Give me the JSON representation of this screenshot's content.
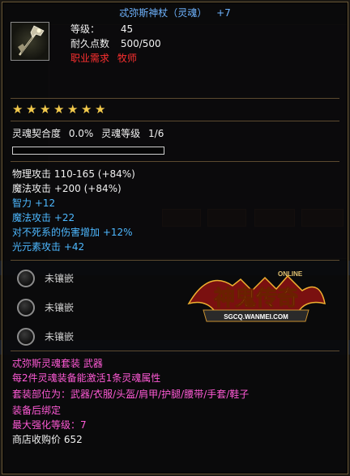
{
  "item": {
    "name": "忒弥斯神杖（灵魂）",
    "enhance": "+7",
    "level_label": "等级：",
    "level_value": "45",
    "durability_label": "耐久点数",
    "durability_value": "500/500",
    "class_req_label": "职业需求",
    "class_req_value": "牧师",
    "stars": 7,
    "soul": {
      "fit_label": "灵魂契合度",
      "fit_value": "0.0%",
      "level_label": "灵魂等级",
      "level_value": "1/6",
      "progress": 0
    },
    "stats": [
      {
        "text": "物理攻击 110-165 (+84%)",
        "color": "white"
      },
      {
        "text": "魔法攻击 +200 (+84%)",
        "color": "white"
      },
      {
        "text": "智力 +12",
        "color": "blue"
      },
      {
        "text": "魔法攻击 +22",
        "color": "blue"
      },
      {
        "text": "对不死系的伤害增加 +12%",
        "color": "blue"
      },
      {
        "text": "光元素攻击 +42",
        "color": "blue"
      }
    ],
    "sockets": [
      "未镶嵌",
      "未镶嵌",
      "未镶嵌"
    ],
    "set_name": "忒弥斯灵魂套装 武器",
    "set_desc": "每2件灵魂装备能激活1条灵魂属性",
    "set_parts": "套装部位为：武器/衣服/头盔/肩甲/护腿/腰带/手套/鞋子",
    "bind": "装备后绑定",
    "max_enhance": "最大强化等级：7",
    "shop_price": "商店收购价 652"
  },
  "logo": {
    "name": "神鬼传奇",
    "online": "ONLINE",
    "url": "SGCQ.WANMEI.COM"
  },
  "colors": {
    "title": "#6fb4ff",
    "requirement": "#ff3030",
    "bonus": "#4db8ff",
    "set": "#ff5ad6",
    "star": "#f2c94c"
  }
}
